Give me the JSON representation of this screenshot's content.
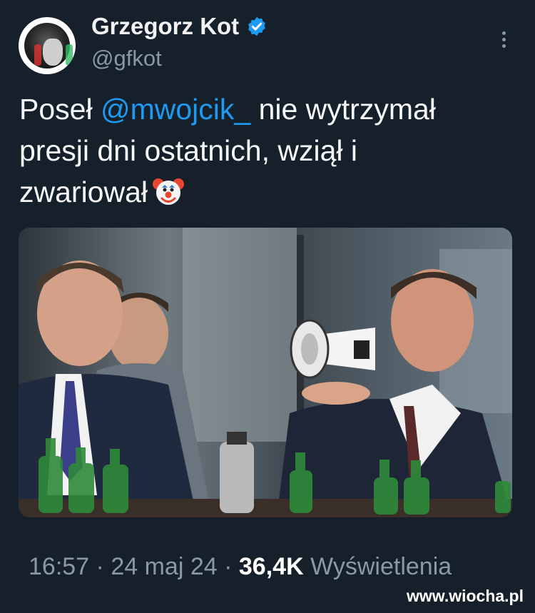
{
  "author": {
    "name": "Grzegorz Kot",
    "handle": "@gfkot",
    "verified": true
  },
  "tweet": {
    "text_before": "Poseł ",
    "mention": "@mwojcik_",
    "text_after_line1": " nie wytrzymał",
    "text_line2": "presji dni ostatnich, wziął i",
    "text_line3": "zwariował",
    "emoji": "clown-face-emoji"
  },
  "photo": {
    "subject": "photo of men at a parliamentary committee table, one speaking into a megaphone"
  },
  "meta": {
    "time": "16:57",
    "separator": "·",
    "date": "24 maj 24",
    "views_count": "36,4K",
    "views_label": "Wyświetlenia"
  },
  "watermark": "www.wiocha.pl",
  "colors": {
    "background": "#15202b",
    "mention": "#1d9bf0",
    "secondary_text": "#8b98a5",
    "verified": "#1d9bf0"
  }
}
